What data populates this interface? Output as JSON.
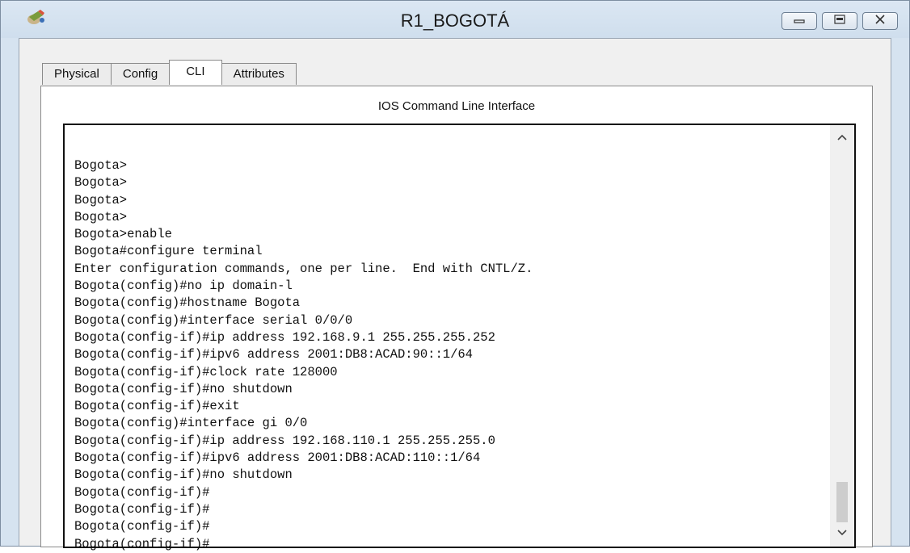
{
  "window": {
    "title": "R1_BOGOTÁ",
    "icon": "packet-tracer-router-icon"
  },
  "window_buttons": [
    {
      "name": "minimize-button",
      "icon": "minimize-icon"
    },
    {
      "name": "maximize-button",
      "icon": "maximize-icon"
    },
    {
      "name": "close-button",
      "icon": "close-icon"
    }
  ],
  "tabs": [
    {
      "label": "Physical",
      "active": false
    },
    {
      "label": "Config",
      "active": false
    },
    {
      "label": "CLI",
      "active": true
    },
    {
      "label": "Attributes",
      "active": false
    }
  ],
  "panel": {
    "title": "IOS Command Line Interface"
  },
  "terminal": {
    "lines": [
      "Bogota>",
      "Bogota>",
      "Bogota>",
      "Bogota>",
      "Bogota>enable",
      "Bogota#configure terminal",
      "Enter configuration commands, one per line.  End with CNTL/Z.",
      "Bogota(config)#no ip domain-l",
      "Bogota(config)#hostname Bogota",
      "Bogota(config)#interface serial 0/0/0",
      "Bogota(config-if)#ip address 192.168.9.1 255.255.255.252",
      "Bogota(config-if)#ipv6 address 2001:DB8:ACAD:90::1/64",
      "Bogota(config-if)#clock rate 128000",
      "Bogota(config-if)#no shutdown",
      "Bogota(config-if)#exit",
      "Bogota(config)#interface gi 0/0",
      "Bogota(config-if)#ip address 192.168.110.1 255.255.255.0",
      "Bogota(config-if)#ipv6 address 2001:DB8:ACAD:110::1/64",
      "Bogota(config-if)#no shutdown",
      "Bogota(config-if)#",
      "Bogota(config-if)#",
      "Bogota(config-if)#",
      "Bogota(config-if)#"
    ]
  },
  "colors": {
    "titlebar": "#d6e3f0",
    "terminal_bg": "#ffffff",
    "terminal_border": "#111111"
  }
}
